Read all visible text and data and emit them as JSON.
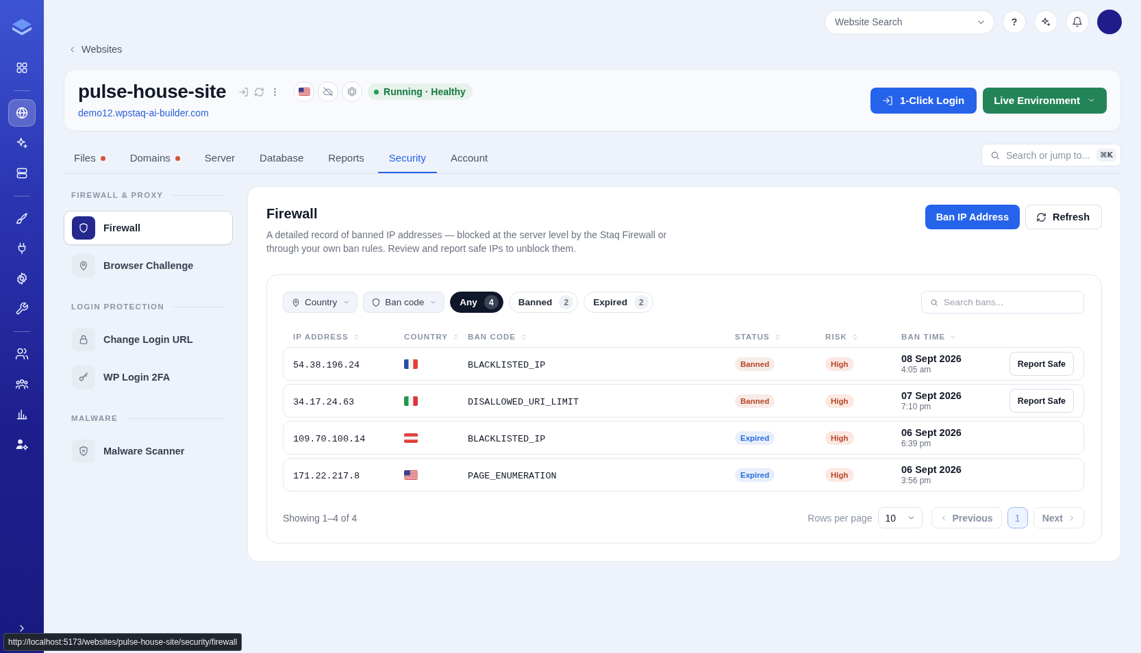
{
  "rail": {
    "groups": [
      {
        "items": [
          {
            "selected": false
          }
        ]
      },
      {
        "items": [
          {
            "selected": true
          },
          {
            "selected": false
          },
          {
            "selected": false
          }
        ]
      },
      {
        "items": [
          {
            "selected": false
          },
          {
            "selected": false
          },
          {
            "selected": false
          },
          {
            "selected": false
          }
        ]
      },
      {
        "items": [
          {
            "selected": false
          },
          {
            "selected": false
          },
          {
            "selected": false
          },
          {
            "selected": false
          }
        ]
      }
    ]
  },
  "top_bar": {
    "website_search": {
      "placeholder": "Website Search"
    },
    "help_button": {
      "label": "?"
    }
  },
  "breadcrumb": {
    "label": "Websites"
  },
  "site": {
    "name": "pulse-house-site",
    "url": "demo12.wpstaq-ai-builder.com",
    "status": "Running · Healthy",
    "actions": [
      {
        "kind": "login",
        "label": "1-Click Login"
      },
      {
        "kind": "environment",
        "label": "Live Environment"
      }
    ]
  },
  "tabs": [
    {
      "label": "Files",
      "selected": false,
      "alert": true
    },
    {
      "label": "Domains",
      "selected": false,
      "alert": true
    },
    {
      "label": "Server",
      "selected": false,
      "alert": false
    },
    {
      "label": "Database",
      "selected": false,
      "alert": false
    },
    {
      "label": "Reports",
      "selected": false,
      "alert": false
    },
    {
      "label": "Security",
      "selected": true,
      "alert": false
    },
    {
      "label": "Account",
      "selected": false,
      "alert": false
    }
  ],
  "jump_search": {
    "placeholder": "Search or jump to...",
    "shortcut": "⌘K"
  },
  "sidebar": {
    "sections": [
      {
        "title": "FIREWALL & PROXY",
        "items": [
          {
            "label": "Firewall",
            "selected": true
          },
          {
            "label": "Browser Challenge",
            "selected": false
          }
        ]
      },
      {
        "title": "LOGIN PROTECTION",
        "items": [
          {
            "label": "Change Login URL",
            "selected": false
          },
          {
            "label": "WP Login 2FA",
            "selected": false
          }
        ]
      },
      {
        "title": "MALWARE",
        "items": [
          {
            "label": "Malware Scanner",
            "selected": false
          }
        ]
      }
    ]
  },
  "panel": {
    "title": "Firewall",
    "description": "A detailed record of banned IP addresses — blocked at the server level by the Staq Firewall or through your own ban rules. Review and report safe IPs to unblock them.",
    "actions": [
      {
        "kind": "primary",
        "label": "Ban IP Address"
      },
      {
        "kind": "refresh",
        "label": "Refresh"
      }
    ],
    "filters": [
      {
        "label": "Country"
      },
      {
        "label": "Ban code"
      }
    ],
    "status_chips": [
      {
        "label": "Any",
        "count": "4",
        "selected": true
      },
      {
        "label": "Banned",
        "count": "2",
        "selected": false
      },
      {
        "label": "Expired",
        "count": "2",
        "selected": false
      }
    ],
    "search": {
      "placeholder": "Search bans..."
    },
    "table": {
      "columns": [
        {
          "label": "IP ADDRESS",
          "sorted": false
        },
        {
          "label": "COUNTRY",
          "sorted": false
        },
        {
          "label": "BAN CODE",
          "sorted": false
        },
        {
          "label": "STATUS",
          "sorted": false
        },
        {
          "label": "RISK",
          "sorted": false
        },
        {
          "label": "BAN TIME",
          "sorted": true
        }
      ],
      "rows": [
        {
          "ip": "54.38.196.24",
          "country_flag": {
            "kind": "france"
          },
          "ban_code": "BLACKLISTED_IP",
          "status": {
            "label": "Banned",
            "color": "#b7472a"
          },
          "risk": "High",
          "ban_time": {
            "date": "08 Sept 2026",
            "time": "4:05 am"
          },
          "action": "Report Safe"
        },
        {
          "ip": "34.17.24.63",
          "country_flag": {
            "kind": "italy"
          },
          "ban_code": "DISALLOWED_URI_LIMIT",
          "status": {
            "label": "Banned",
            "color": "#b7472a"
          },
          "risk": "High",
          "ban_time": {
            "date": "07 Sept 2026",
            "time": "7:10 pm"
          },
          "action": "Report Safe"
        },
        {
          "ip": "109.70.100.14",
          "country_flag": {
            "kind": "austria"
          },
          "ban_code": "BLACKLISTED_IP",
          "status": {
            "label": "Expired",
            "color": "#2d6cdf"
          },
          "risk": "High",
          "ban_time": {
            "date": "06 Sept 2026",
            "time": "6:39 pm"
          }
        },
        {
          "ip": "171.22.217.8",
          "country_flag": {
            "kind": "us"
          },
          "ban_code": "PAGE_ENUMERATION",
          "status": {
            "label": "Expired",
            "color": "#2d6cdf"
          },
          "risk": "High",
          "ban_time": {
            "date": "06 Sept 2026",
            "time": "3:56 pm"
          }
        }
      ],
      "footer": {
        "summary": "Showing 1–4 of 4",
        "rows_per_page": {
          "label": "Rows per page",
          "value": "10"
        },
        "previous": {
          "label": "Previous",
          "disabled": true
        },
        "pages": [
          {
            "label": "1",
            "selected": true
          }
        ],
        "next": {
          "label": "Next",
          "disabled": true
        }
      }
    }
  },
  "link_preview": "http://localhost:5173/websites/pulse-house-site/security/firewall"
}
